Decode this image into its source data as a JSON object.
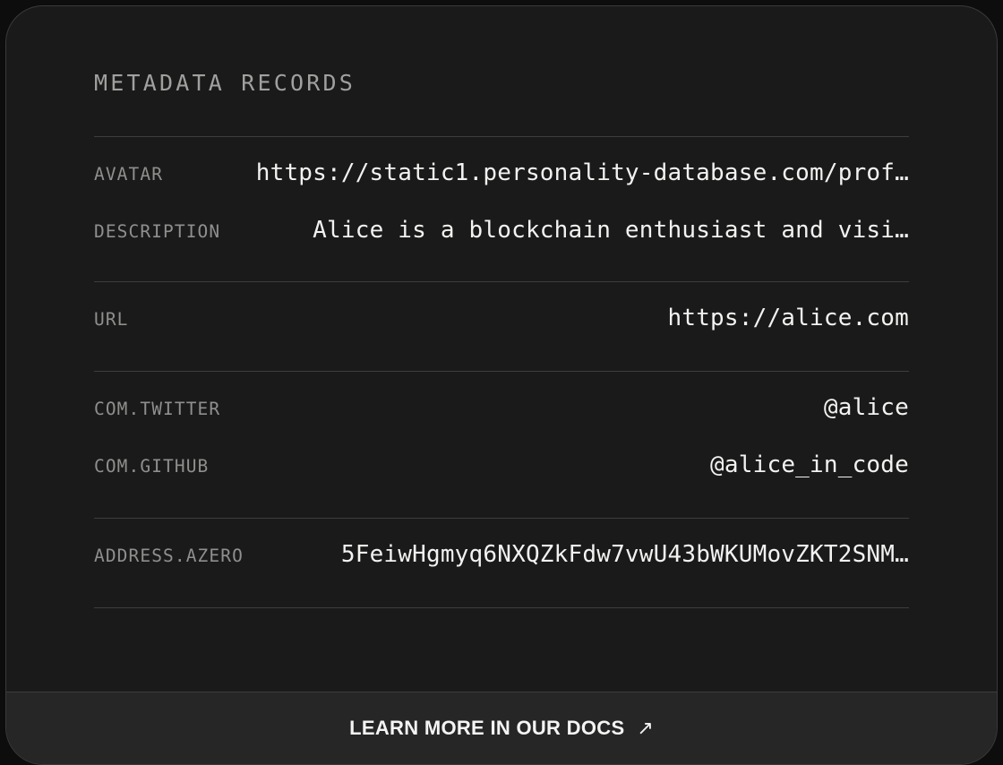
{
  "card": {
    "title": "METADATA RECORDS",
    "accent_color": "#f2f2f0",
    "background_color": "#1a1a1a",
    "divider_color": "#3d3d3b",
    "label_color": "#8f8f8d"
  },
  "groups": [
    {
      "rows": [
        {
          "label": "AVATAR",
          "value": "https://static1.personality-database.com/prof…"
        },
        {
          "label": "DESCRIPTION",
          "value": "Alice is a blockchain enthusiast and visi…"
        }
      ]
    },
    {
      "rows": [
        {
          "label": "URL",
          "value": "https://alice.com"
        }
      ]
    },
    {
      "rows": [
        {
          "label": "COM.TWITTER",
          "value": "@alice"
        },
        {
          "label": "COM.GITHUB",
          "value": "@alice_in_code"
        }
      ]
    },
    {
      "rows": [
        {
          "label": "ADDRESS.AZERO",
          "value": "5FeiwHgmyq6NXQZkFdw7vwU43bWKUMovZKT2SNM…"
        }
      ]
    }
  ],
  "footer": {
    "label": "LEARN MORE IN OUR DOCS",
    "arrow_icon": "↗"
  }
}
